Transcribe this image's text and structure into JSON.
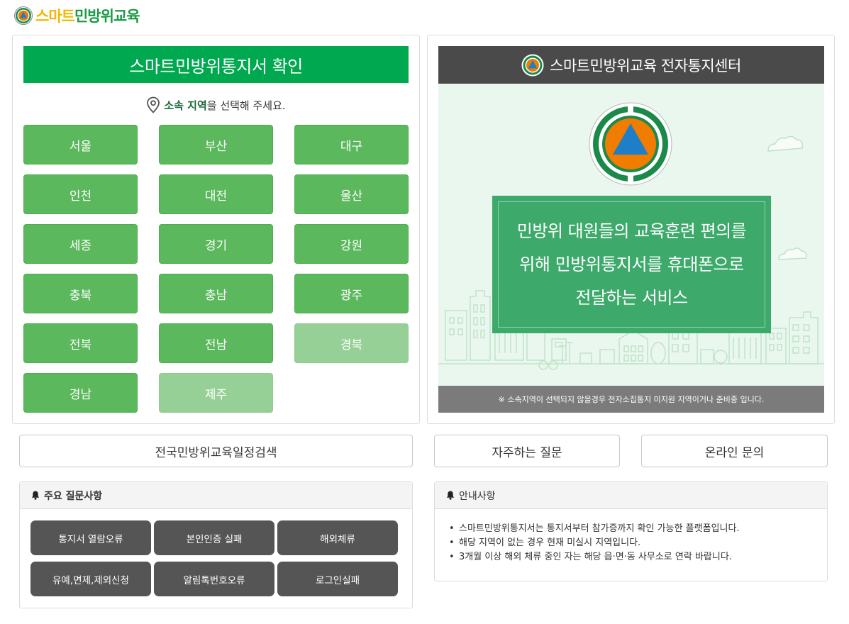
{
  "header": {
    "logo_part1": "스마트",
    "logo_part2": "민방위교육"
  },
  "left_panel": {
    "title": "스마트민방위통지서 확인",
    "hint_bold": "소속 지역",
    "hint_rest": "을 선택해 주세요.",
    "regions": [
      {
        "label": "서울",
        "enabled": true
      },
      {
        "label": "부산",
        "enabled": true
      },
      {
        "label": "대구",
        "enabled": true
      },
      {
        "label": "인천",
        "enabled": true
      },
      {
        "label": "대전",
        "enabled": true
      },
      {
        "label": "울산",
        "enabled": true
      },
      {
        "label": "세종",
        "enabled": true
      },
      {
        "label": "경기",
        "enabled": true
      },
      {
        "label": "강원",
        "enabled": true
      },
      {
        "label": "충북",
        "enabled": true
      },
      {
        "label": "충남",
        "enabled": true
      },
      {
        "label": "광주",
        "enabled": true
      },
      {
        "label": "전북",
        "enabled": true
      },
      {
        "label": "전남",
        "enabled": true
      },
      {
        "label": "경북",
        "enabled": false
      },
      {
        "label": "경남",
        "enabled": true
      },
      {
        "label": "제주",
        "enabled": false
      }
    ]
  },
  "right_panel": {
    "title": "스마트민방위교육 전자통지센터",
    "message_line1": "민방위 대원들의 교육훈련 편의를",
    "message_line2": "위해 민방위통지서를 휴대폰으로",
    "message_line3": "전달하는 서비스",
    "notice": "※ 소속지역이 선택되지 않을경우 전자소집통지 미지원 지역이거나 준비중 입니다."
  },
  "actions": {
    "schedule_search": "전국민방위교육일정검색",
    "faq": "자주하는 질문",
    "online_inquiry": "온라인 문의"
  },
  "faq_box": {
    "title": "주요 질문사항",
    "buttons": [
      "통지서 열람오류",
      "본인인증 실패",
      "해외체류",
      "유예,면제,제외신청",
      "알림톡번호오류",
      "로그인실패"
    ]
  },
  "info_box": {
    "title": "안내사항",
    "items": [
      "스마트민방위통지서는 통지서부터 참가증까지 확인 가능한 플랫폼입니다.",
      "해당 지역이 없는 경우 현재 미실시 지역입니다.",
      "3개월 이상 해외 체류 중인 자는 해당 읍·면·동 사무소로 연락 바랍니다."
    ]
  },
  "colors": {
    "green": "#00a84f",
    "region_green": "#5cb85c",
    "dark": "#4a4a4a",
    "faq_button": "#555555",
    "logo_orange": "#f07c00"
  },
  "icons": [
    "civil-defense-logo-icon",
    "location-pin-icon",
    "bell-icon"
  ]
}
